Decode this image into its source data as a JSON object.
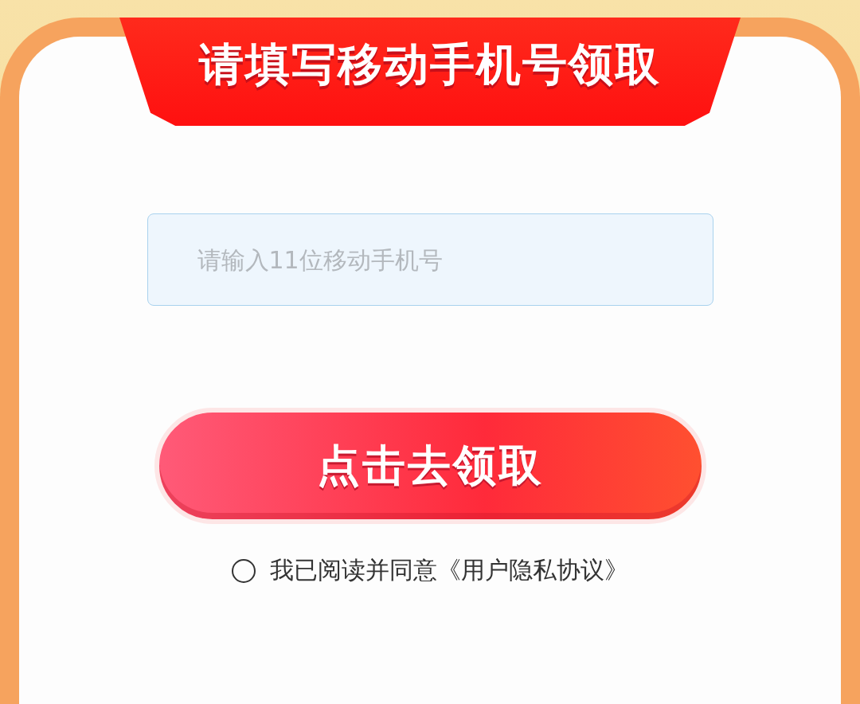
{
  "banner": {
    "title": "请填写移动手机号领取"
  },
  "phone_field": {
    "placeholder": "请输入11位移动手机号"
  },
  "submit_button": {
    "label": "点击去领取"
  },
  "agreement": {
    "checked": false,
    "text": "我已阅读并同意",
    "link": "《用户隐私协议》"
  }
}
